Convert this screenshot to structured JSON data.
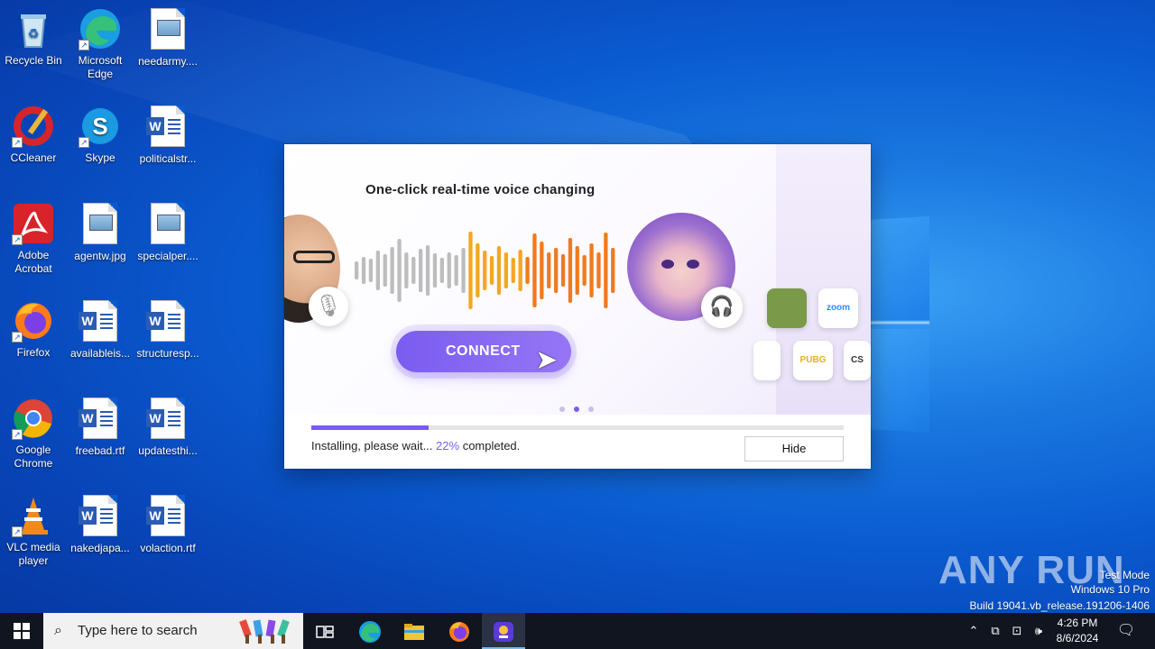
{
  "desktop": {
    "icons": [
      {
        "label": "Recycle Bin"
      },
      {
        "label": "Microsoft Edge"
      },
      {
        "label": "needarmy...."
      },
      {
        "label": "CCleaner"
      },
      {
        "label": "Skype"
      },
      {
        "label": "politicalstr..."
      },
      {
        "label": "Adobe Acrobat"
      },
      {
        "label": "agentw.jpg"
      },
      {
        "label": "specialper...."
      },
      {
        "label": "Firefox"
      },
      {
        "label": "availableis..."
      },
      {
        "label": "structuresp..."
      },
      {
        "label": "Google Chrome"
      },
      {
        "label": "freebad.rtf"
      },
      {
        "label": "updatesthi..."
      },
      {
        "label": "VLC media player"
      },
      {
        "label": "nakedjapa..."
      },
      {
        "label": "volaction.rtf"
      }
    ]
  },
  "installer": {
    "headline": "One-click real-time voice changing",
    "connect_label": "CONNECT",
    "progress": 0.22,
    "status_prefix": "Installing, please wait...",
    "status_pct": "22%",
    "status_suffix": "completed.",
    "hide_label": "Hide",
    "app_tiles": [
      "zoom",
      "PUBG",
      "CS"
    ]
  },
  "watermark": {
    "brand": "ANY RUN",
    "line1": "Test Mode",
    "line2": "Windows 10 Pro",
    "line3": "Build 19041.vb_release.191206-1406"
  },
  "taskbar": {
    "search_placeholder": "Type here to search",
    "time": "4:26 PM",
    "date": "8/6/2024"
  },
  "colors": {
    "accent": "#7a5cf0",
    "desktop_blue": "#0a5bd0",
    "taskbar": "#101520"
  }
}
